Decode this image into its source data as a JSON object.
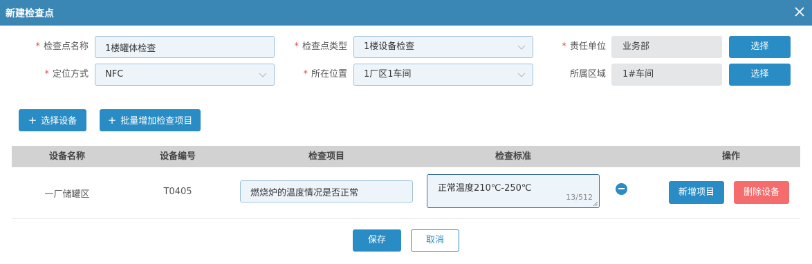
{
  "dialog": {
    "title": "新建检查点",
    "close_icon": "close-icon"
  },
  "form": {
    "checkpoint_name": {
      "label": "检查点名称",
      "required": true,
      "value": "1楼罐体检查"
    },
    "checkpoint_type": {
      "label": "检查点类型",
      "required": true,
      "value": "1楼设备检查"
    },
    "responsible_unit": {
      "label": "责任单位",
      "required": true,
      "value": "业务部",
      "button": "选择"
    },
    "positioning": {
      "label": "定位方式",
      "required": true,
      "value": "NFC"
    },
    "location": {
      "label": "所在位置",
      "required": true,
      "value": "1厂区1车间"
    },
    "area": {
      "label": "所属区域",
      "required": false,
      "value": "1#车间",
      "button": "选择"
    },
    "required_mark": "*"
  },
  "toolbar": {
    "select_device": "选择设备",
    "batch_add": "批量增加检查项目",
    "plus_icon": "+"
  },
  "table": {
    "columns": [
      "设备名称",
      "设备编号",
      "检查项目",
      "检查标准",
      "操作"
    ],
    "rows": [
      {
        "device_name": "一厂储罐区",
        "device_no": "T0405",
        "item": "燃烧炉的温度情况是否正常",
        "standard": "正常温度210℃-250℃",
        "counter": "13/512",
        "add_item": "新增项目",
        "delete_device": "删除设备"
      }
    ]
  },
  "footer": {
    "save": "保存",
    "cancel": "取消"
  },
  "colors": {
    "header": "#3a86b4",
    "primary": "#2a8cc4",
    "danger": "#f56c6c",
    "required": "#e04a4a"
  }
}
